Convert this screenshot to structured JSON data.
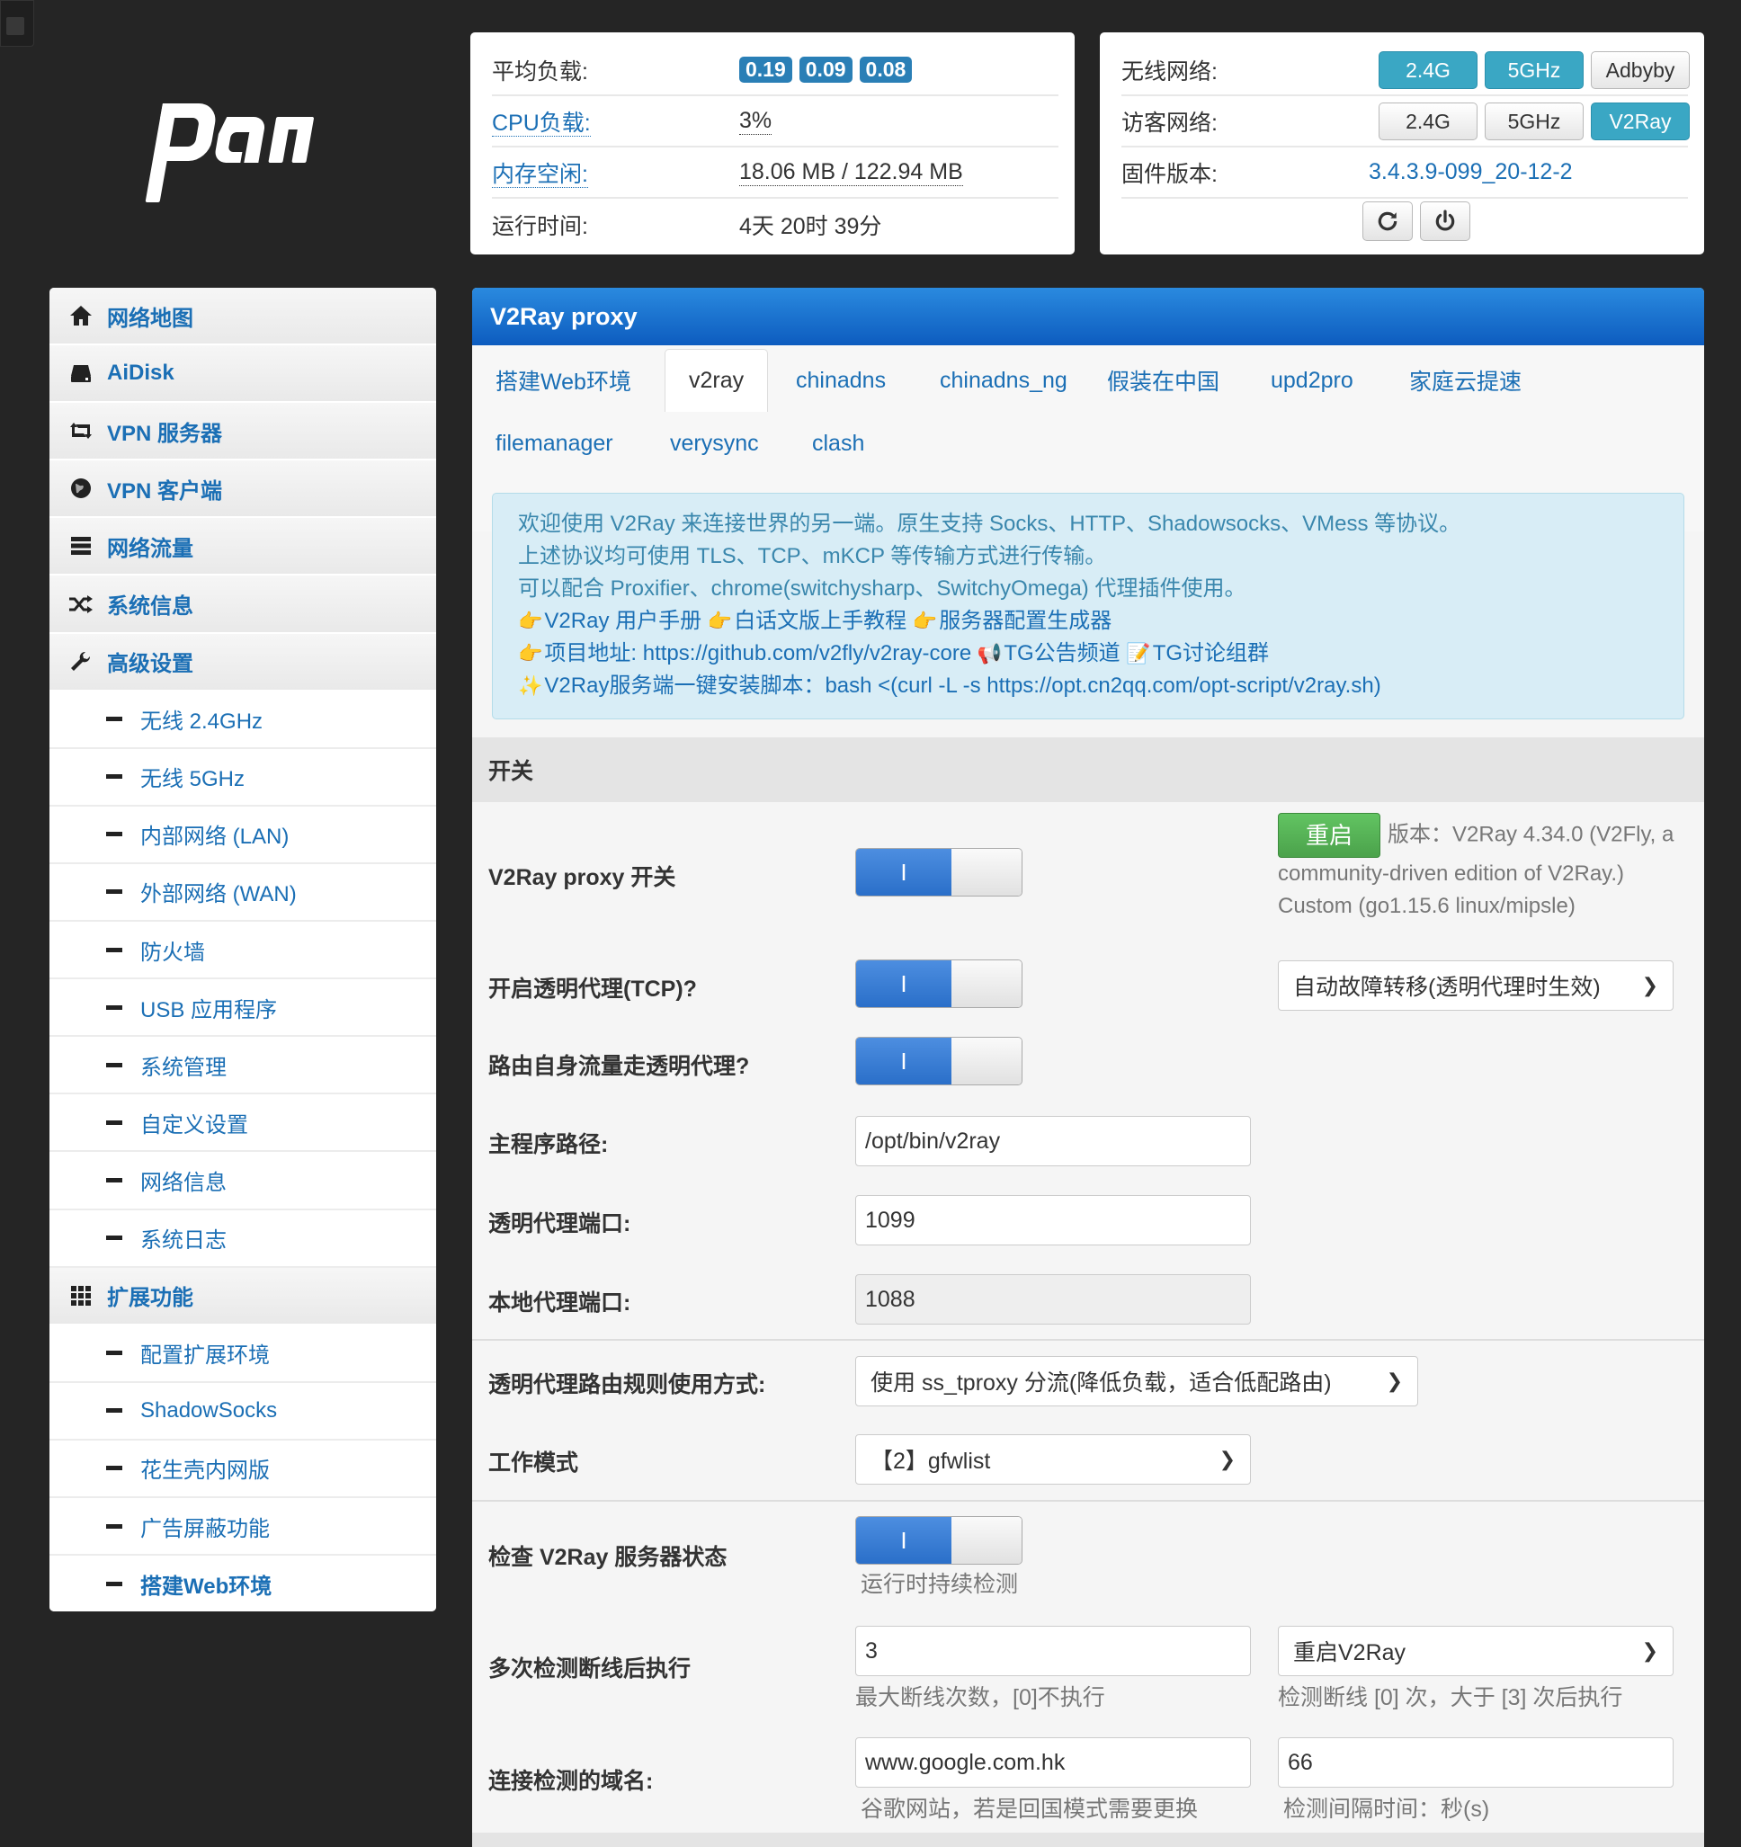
{
  "logo_text": "padavan",
  "status": {
    "load_label": "平均负载:",
    "load_values": [
      "0.19",
      "0.09",
      "0.08"
    ],
    "cpu_label": "CPU负载:",
    "cpu_value": "3%",
    "mem_label": "内存空闲:",
    "mem_value": "18.06 MB / 122.94 MB",
    "uptime_label": "运行时间:",
    "uptime_value": "4天 20时 39分"
  },
  "network": {
    "wireless_label": "无线网络:",
    "wireless_buttons": [
      "2.4G",
      "5GHz",
      "Adbyby"
    ],
    "guest_label": "访客网络:",
    "guest_buttons": [
      "2.4G",
      "5GHz",
      "V2Ray"
    ],
    "firmware_label": "固件版本:",
    "firmware_value": "3.4.3.9-099_20-12-2"
  },
  "sidebar": {
    "items": [
      {
        "label": "网络地图",
        "icon": "home-icon"
      },
      {
        "label": "AiDisk",
        "icon": "disk-icon"
      },
      {
        "label": "VPN 服务器",
        "icon": "retweet-icon"
      },
      {
        "label": "VPN 客户端",
        "icon": "globe-icon"
      },
      {
        "label": "网络流量",
        "icon": "list-icon"
      },
      {
        "label": "系统信息",
        "icon": "shuffle-icon"
      },
      {
        "label": "高级设置",
        "icon": "wrench-icon"
      }
    ],
    "advanced": [
      "无线 2.4GHz",
      "无线 5GHz",
      "内部网络 (LAN)",
      "外部网络 (WAN)",
      "防火墙",
      "USB 应用程序",
      "系统管理",
      "自定义设置",
      "网络信息",
      "系统日志"
    ],
    "ext_label": "扩展功能",
    "ext_icon": "grid-icon",
    "extensions": [
      "配置扩展环境",
      "ShadowSocks",
      "花生壳内网版",
      "广告屏蔽功能",
      "搭建Web环境"
    ]
  },
  "main": {
    "title": "V2Ray proxy",
    "tabs": [
      "搭建Web环境",
      "v2ray",
      "chinadns",
      "chinadns_ng",
      "假装在中国",
      "upd2pro",
      "家庭云提速",
      "filemanager",
      "verysync",
      "clash"
    ],
    "info": {
      "line1": "欢迎使用 V2Ray 来连接世界的另一端。原生支持 Socks、HTTP、Shadowsocks、VMess 等协议。",
      "line2": "上述协议均可使用 TLS、TCP、mKCP 等传输方式进行传输。",
      "line3": "可以配合 Proxifier、chrome(switchysharp、SwitchyOmega) 代理插件使用。",
      "link_manual": "V2Ray 用户手册",
      "link_tutorial": "白话文版上手教程",
      "link_generator": "服务器配置生成器",
      "link_project": "项目地址: https://github.com/v2fly/v2ray-core",
      "link_tg_channel": "TG公告频道",
      "link_tg_group": "TG讨论组群",
      "link_install": "V2Ray服务端一键安装脚本：bash <(curl -L -s https://opt.cn2qq.com/opt-script/v2ray.sh)"
    },
    "section_switch": "开关",
    "proxy_switch_label": "V2Ray proxy 开关",
    "toggle_on_text": "I",
    "restart_button": "重启",
    "version_text": "版本：V2Ray 4.34.0 (V2Fly, a community-driven edition of V2Ray.) Custom (go1.15.6 linux/mipsle)",
    "tcp_label": "开启透明代理(TCP)?",
    "failover_select": "自动故障转移(透明代理时生效)",
    "self_traffic_label": "路由自身流量走透明代理?",
    "path_label": "主程序路径:",
    "path_value": "/opt/bin/v2ray",
    "tproxy_port_label": "透明代理端口:",
    "tproxy_port_value": "1099",
    "local_port_label": "本地代理端口:",
    "local_port_value": "1088",
    "rule_mode_label": "透明代理路由规则使用方式:",
    "rule_mode_value": "使用 ss_tproxy 分流(降低负载，适合低配路由)",
    "work_mode_label": "工作模式",
    "work_mode_value": "【2】gfwlist",
    "check_label": "检查 V2Ray 服务器状态",
    "check_hint": "运行时持续检测",
    "retry_label": "多次检测断线后执行",
    "retry_value": "3",
    "retry_hint": "最大断线次数，[0]不执行",
    "retry_action": "重启V2Ray",
    "retry_action_hint": "检测断线 [0] 次，大于 [3] 次后执行",
    "domain_label": "连接检测的域名:",
    "domain_value": "www.google.com.hk",
    "domain_hint": "谷歌网站，若是回国模式需要更换",
    "interval_value": "66",
    "interval_hint": "检测间隔时间：秒(s)"
  }
}
